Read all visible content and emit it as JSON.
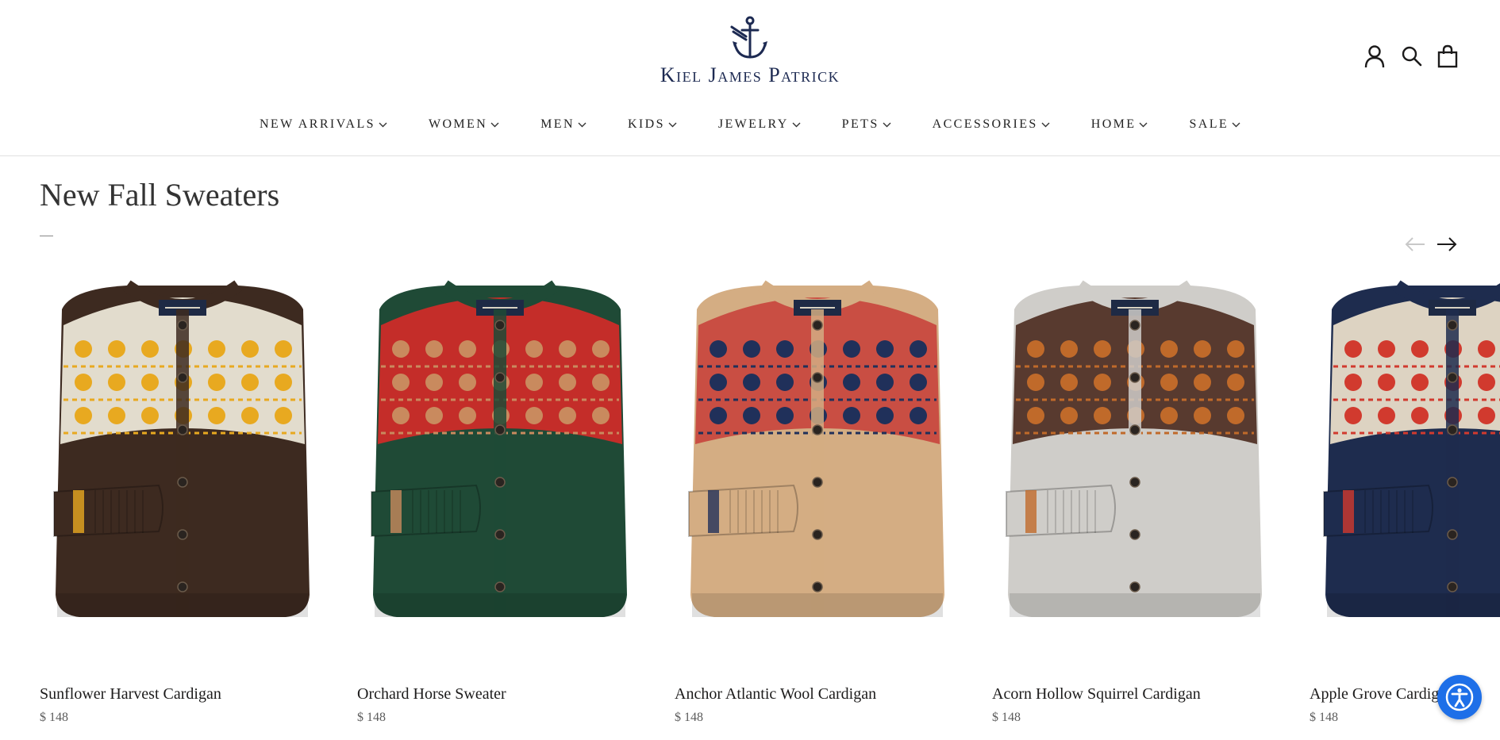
{
  "brand": {
    "name": "Kiel James Patrick",
    "color": "#1d2a52"
  },
  "header": {
    "icons": [
      "account-icon",
      "search-icon",
      "shopping-bag-icon"
    ]
  },
  "nav": {
    "items": [
      {
        "label": "NEW ARRIVALS"
      },
      {
        "label": "WOMEN"
      },
      {
        "label": "MEN"
      },
      {
        "label": "KIDS"
      },
      {
        "label": "JEWELRY"
      },
      {
        "label": "PETS"
      },
      {
        "label": "ACCESSORIES"
      },
      {
        "label": "HOME"
      },
      {
        "label": "SALE"
      }
    ]
  },
  "section": {
    "title": "New Fall Sweaters",
    "carousel_controls": [
      "arrow-left-icon",
      "arrow-right-icon"
    ]
  },
  "products": [
    {
      "name": "Sunflower Harvest Cardigan",
      "price": "$ 148",
      "base_color": "#3d2a20",
      "pattern_color": "#e8a920",
      "accent_color": "#f4efe0"
    },
    {
      "name": "Orchard Horse Sweater",
      "price": "$ 148",
      "base_color": "#1f4a36",
      "pattern_color": "#c98a5e",
      "accent_color": "#d62a28"
    },
    {
      "name": "Anchor Atlantic Wool Cardigan",
      "price": "$ 148",
      "base_color": "#d4ad83",
      "pattern_color": "#20305a",
      "accent_color": "#c8443c"
    },
    {
      "name": "Acorn Hollow Squirrel Cardigan",
      "price": "$ 148",
      "base_color": "#cfcdc9",
      "pattern_color": "#c06a2a",
      "accent_color": "#4a2a1e"
    },
    {
      "name": "Apple Grove Cardigan",
      "price": "$ 148",
      "base_color": "#1e2c4e",
      "pattern_color": "#d13a2e",
      "accent_color": "#f2e6cf"
    }
  ],
  "accessibility": {
    "icon": "accessibility-icon",
    "color": "#1e6fe8"
  }
}
